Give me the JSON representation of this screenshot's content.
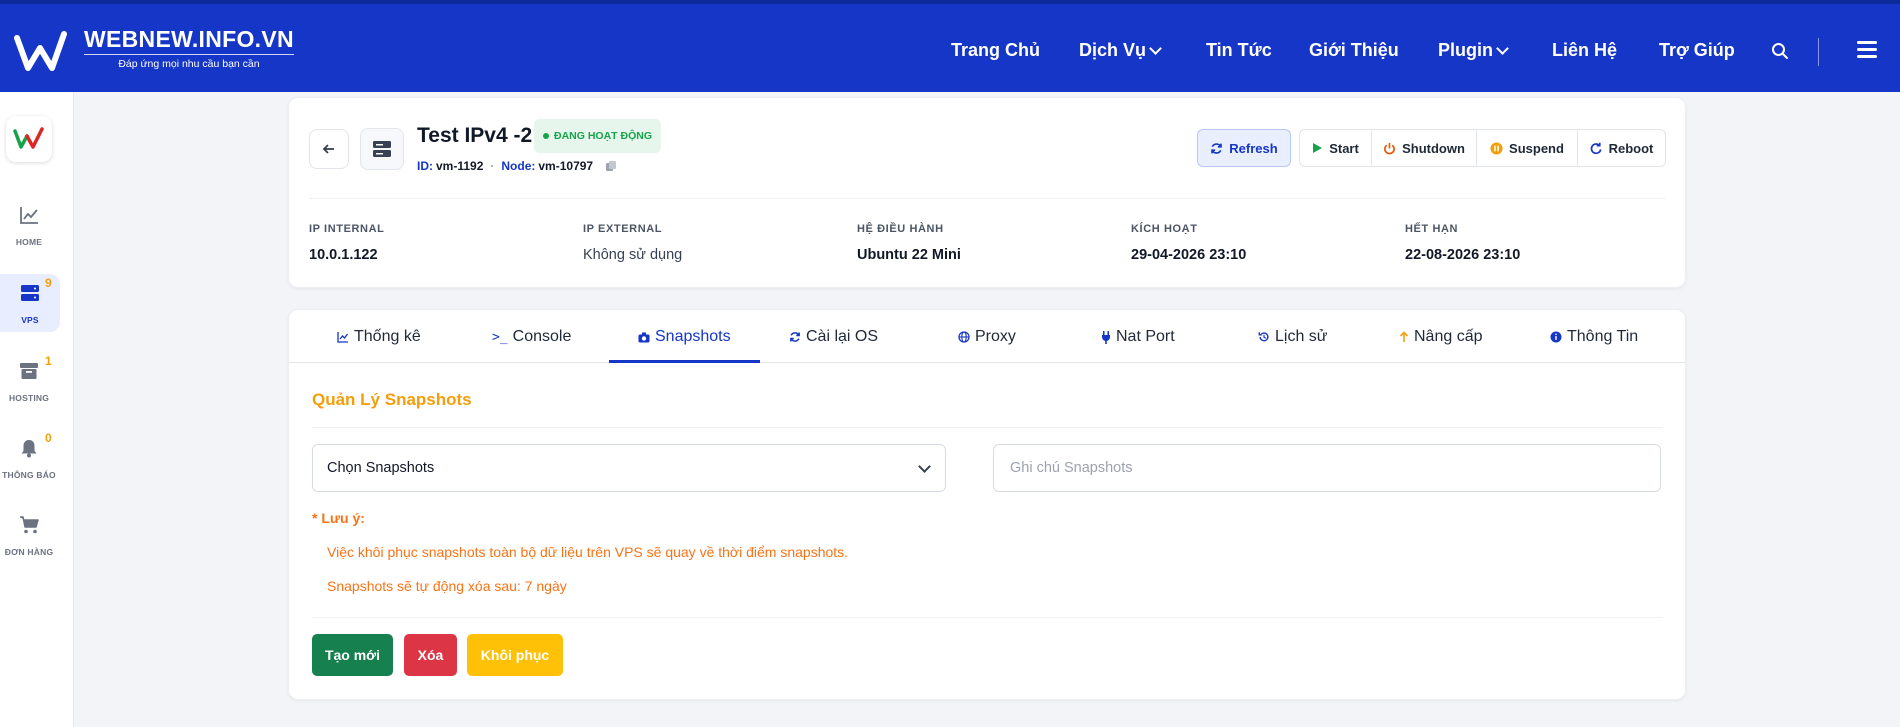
{
  "header": {
    "logo_title": "WEBNEW.INFO.VN",
    "logo_tagline": "Đáp ứng mọi nhu cầu bạn cần",
    "nav": [
      {
        "label": "Trang Chủ",
        "dropdown": false
      },
      {
        "label": "Dịch Vụ",
        "dropdown": true
      },
      {
        "label": "Tin Tức",
        "dropdown": false
      },
      {
        "label": "Giới Thiệu",
        "dropdown": false
      },
      {
        "label": "Plugin",
        "dropdown": true
      },
      {
        "label": "Liên Hệ",
        "dropdown": false
      },
      {
        "label": "Trợ Giúp",
        "dropdown": false
      }
    ],
    "icons": [
      "search-icon",
      "hamburger-menu-icon"
    ],
    "brand_color": "#1536c6"
  },
  "sidebar": {
    "items": [
      {
        "label": "HOME",
        "icon": "chart-line-icon",
        "badge": ""
      },
      {
        "label": "VPS",
        "icon": "server-icon",
        "badge": "9",
        "active": true
      },
      {
        "label": "HOSTING",
        "icon": "archive-box-icon",
        "badge": "1"
      },
      {
        "label": "THÔNG BÁO",
        "icon": "bell-icon",
        "badge": "0"
      },
      {
        "label": "ĐƠN HÀNG",
        "icon": "cart-icon",
        "badge": ""
      }
    ]
  },
  "vm": {
    "title": "Test IPv4 -2",
    "status": "ĐANG HOẠT ĐỘNG",
    "id_label": "ID:",
    "id_value": "vm-1192",
    "node_label": "Node:",
    "node_value": "vm-10797",
    "actions": {
      "refresh": "Refresh",
      "start": "Start",
      "shutdown": "Shutdown",
      "suspend": "Suspend",
      "reboot": "Reboot"
    },
    "info": [
      {
        "label": "IP INTERNAL",
        "value": "10.0.1.122"
      },
      {
        "label": "IP EXTERNAL",
        "value": "Không sử dụng"
      },
      {
        "label": "HỆ ĐIỀU HÀNH",
        "value": "Ubuntu 22 Mini"
      },
      {
        "label": "KÍCH HOẠT",
        "value": "29-04-2026 23:10"
      },
      {
        "label": "HẾT HẠN",
        "value": "22-08-2026 23:10"
      }
    ]
  },
  "tabs": [
    {
      "label": "Thống kê",
      "icon": "chart-icon"
    },
    {
      "label": "Console",
      "icon": "terminal-icon"
    },
    {
      "label": "Snapshots",
      "icon": "camera-icon",
      "active": true
    },
    {
      "label": "Cài lại OS",
      "icon": "sync-icon"
    },
    {
      "label": "Proxy",
      "icon": "globe-icon"
    },
    {
      "label": "Nat Port",
      "icon": "plug-icon"
    },
    {
      "label": "Lịch sử",
      "icon": "history-icon"
    },
    {
      "label": "Nâng cấp",
      "icon": "arrow-up-icon"
    },
    {
      "label": "Thông Tin",
      "icon": "info-icon"
    }
  ],
  "snapshots": {
    "title": "Quản Lý Snapshots",
    "select_value": "Chọn Snapshots",
    "note_placeholder": "Ghi chú Snapshots",
    "warning_title": "* Lưu ý:",
    "warning_lines": [
      "Việc khôi phục snapshots toàn bộ dữ liệu trên VPS sẽ quay về thời điểm snapshots.",
      "Snapshots sẽ tự động xóa sau: 7 ngày"
    ],
    "buttons": {
      "create": "Tạo mới",
      "delete": "Xóa",
      "restore": "Khôi phục"
    }
  }
}
